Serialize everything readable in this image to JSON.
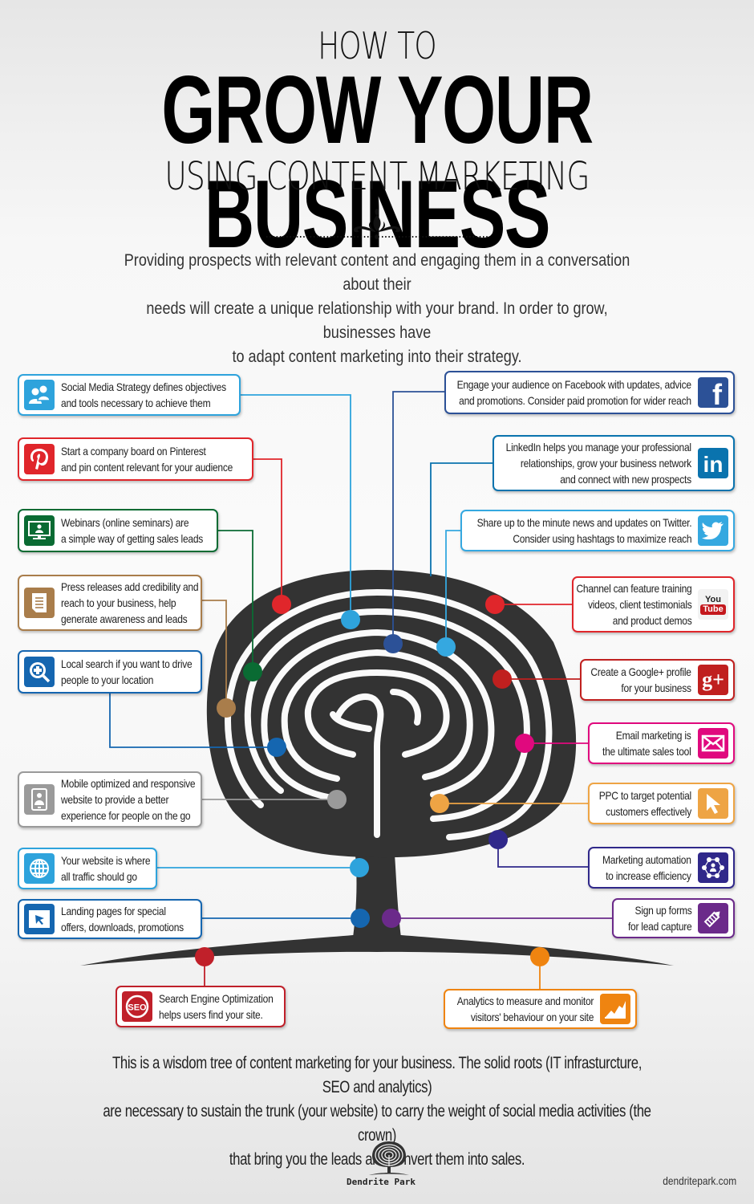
{
  "header": {
    "pre_title": "HOW TO",
    "title": "GROW YOUR BUSINESS",
    "subtitle": "USING CONTENT MARKETING",
    "intro_lines": [
      "Providing prospects with relevant content and engaging them in a conversation about their",
      "needs will create a unique relationship with your brand. In order to grow, businesses have",
      "to adapt content marketing into their strategy."
    ]
  },
  "colors": {
    "tree": "#333333",
    "social_media": "#2ea3dc",
    "pinterest": "#e0262b",
    "webinars": "#0a6b33",
    "press": "#a97d4b",
    "local_search": "#1566b0",
    "mobile": "#9a9a9a",
    "website": "#2ea3dc",
    "landing": "#1566b0",
    "seo": "#c0202a",
    "facebook": "#2c5197",
    "linkedin": "#0a73ae",
    "twitter": "#35a8e0",
    "youtube": "#e0262b",
    "googleplus": "#c0201f",
    "email": "#e0097e",
    "ppc": "#eea444",
    "automation": "#30288a",
    "signup": "#6b2a8a",
    "analytics": "#ef8410"
  },
  "items": [
    {
      "id": "social-media",
      "side": "left",
      "icon": "social-people-icon",
      "color": "#2ea3dc",
      "lines": [
        "Social Media Strategy defines objectives",
        "and tools necessary to achieve them"
      ]
    },
    {
      "id": "pinterest",
      "side": "left",
      "icon": "pinterest-icon",
      "color": "#e0262b",
      "lines": [
        "Start a company board on Pinterest",
        "and pin content relevant for your audience"
      ]
    },
    {
      "id": "webinars",
      "side": "left",
      "icon": "webinar-monitor-icon",
      "color": "#0a6b33",
      "lines": [
        "Webinars (online seminars) are",
        "a simple way of getting sales leads"
      ]
    },
    {
      "id": "press-releases",
      "side": "left",
      "icon": "document-icon",
      "color": "#a97d4b",
      "lines": [
        "Press releases add credibility and",
        "reach to your business, help",
        "generate awareness and leads"
      ]
    },
    {
      "id": "local-search",
      "side": "left",
      "icon": "search-plus-icon",
      "color": "#1566b0",
      "lines": [
        "Local search if you want to drive",
        "people to your location"
      ]
    },
    {
      "id": "mobile",
      "side": "left",
      "icon": "mobile-phone-icon",
      "color": "#9a9a9a",
      "lines": [
        "Mobile optimized and responsive",
        "website to provide a better",
        "experience for people on the go"
      ]
    },
    {
      "id": "website",
      "side": "left",
      "icon": "globe-icon",
      "color": "#2ea3dc",
      "lines": [
        "Your website is where",
        "all traffic should go"
      ]
    },
    {
      "id": "landing-pages",
      "side": "left",
      "icon": "cursor-window-icon",
      "color": "#1566b0",
      "lines": [
        "Landing pages for special",
        "offers, downloads, promotions"
      ]
    },
    {
      "id": "seo",
      "side": "left",
      "icon": "seo-icon",
      "color": "#c0202a",
      "lines": [
        "Search Engine Optimization",
        "helps users find your site."
      ]
    },
    {
      "id": "facebook",
      "side": "right",
      "icon": "facebook-icon",
      "color": "#2c5197",
      "lines": [
        "Engage your audience on Facebook with updates, advice",
        "and promotions. Consider paid promotion for wider reach"
      ]
    },
    {
      "id": "linkedin",
      "side": "right",
      "icon": "linkedin-icon",
      "color": "#0a73ae",
      "lines": [
        "LinkedIn helps you manage your professional",
        "relationships, grow your business network",
        "and connect with new prospects"
      ]
    },
    {
      "id": "twitter",
      "side": "right",
      "icon": "twitter-icon",
      "color": "#35a8e0",
      "lines": [
        "Share up to the minute news and updates on Twitter.",
        "Consider using hashtags to maximize reach"
      ]
    },
    {
      "id": "youtube",
      "side": "right",
      "icon": "youtube-icon",
      "color": "#e0262b",
      "lines": [
        "Channel can feature training",
        "videos, client testimonials",
        "and product demos"
      ]
    },
    {
      "id": "googleplus",
      "side": "right",
      "icon": "google-plus-icon",
      "color": "#c0201f",
      "lines": [
        "Create a Google+ profile",
        "for your business"
      ]
    },
    {
      "id": "email",
      "side": "right",
      "icon": "envelope-icon",
      "color": "#e0097e",
      "lines": [
        "Email marketing is",
        "the ultimate sales tool"
      ]
    },
    {
      "id": "ppc",
      "side": "right",
      "icon": "pointer-arrow-icon",
      "color": "#eea444",
      "lines": [
        "PPC to target potential",
        "customers effectively"
      ]
    },
    {
      "id": "automation",
      "side": "right",
      "icon": "network-people-icon",
      "color": "#30288a",
      "lines": [
        "Marketing automation",
        "to increase efficiency"
      ]
    },
    {
      "id": "signup",
      "side": "right",
      "icon": "pencil-icon",
      "color": "#6b2a8a",
      "lines": [
        "Sign up forms",
        "for lead capture"
      ]
    },
    {
      "id": "analytics",
      "side": "right",
      "icon": "chart-growth-icon",
      "color": "#ef8410",
      "lines": [
        "Analytics to measure and monitor",
        "visitors' behaviour on your site"
      ]
    }
  ],
  "icon_text": {
    "youtube_top": "You",
    "youtube_bottom": "Tube",
    "seo": "SEO",
    "facebook": "f",
    "linkedin": "in",
    "googleplus": "g+"
  },
  "footer": {
    "lines": [
      "This is a wisdom tree of content marketing for your business. The solid roots (IT infrasturcture, SEO and analytics)",
      "are necessary to sustain the trunk (your website) to carry the weight of social media activities (the crown)",
      "that bring you the leads and convert them into sales."
    ],
    "logo_text": "Dendrite Park",
    "website": "dendritepark.com"
  }
}
